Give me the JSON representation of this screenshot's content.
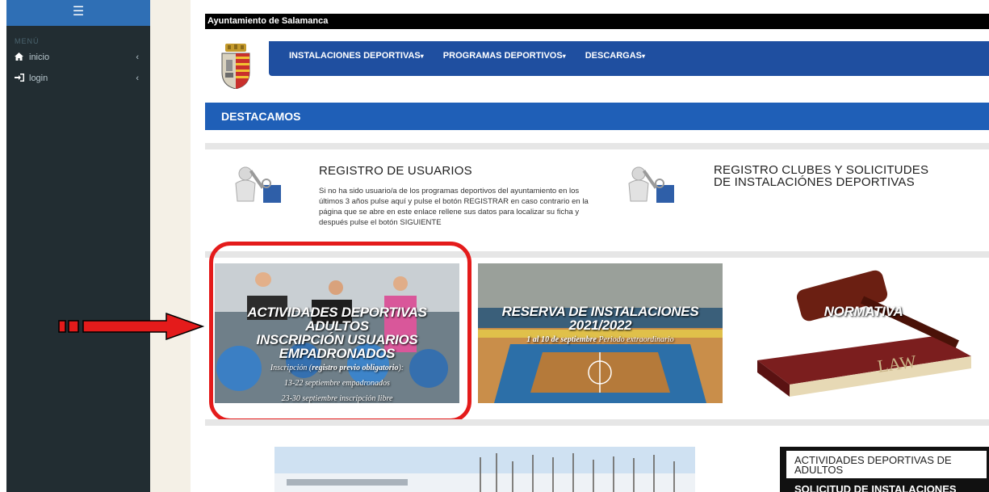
{
  "sidebar": {
    "toggle_icon": "hamburger-icon",
    "menu_title": "MENÚ",
    "items": [
      {
        "icon": "home-icon",
        "label": "inicio"
      },
      {
        "icon": "login-icon",
        "label": "login"
      }
    ]
  },
  "header": {
    "site_title": "Ayuntamiento de Salamanca",
    "nav": [
      {
        "label": "INSTALACIONES DEPORTIVAS"
      },
      {
        "label": "PROGRAMAS DEPORTIVOS"
      },
      {
        "label": "DESCARGAS"
      }
    ]
  },
  "featured": {
    "section_title": "DESTACAMOS",
    "registro_usuarios": {
      "title": "REGISTRO DE USUARIOS",
      "text": "Si no ha sido usuario/a de los programas deportivos del ayuntamiento en los últimos 3 años pulse aquí y pulse el botón REGISTRAR en caso contrario en la página que se abre en este enlace rellene sus datos para localizar su ficha y después pulse el botón SIGUIENTE"
    },
    "registro_clubes": {
      "title_line1": "REGISTRO CLUBES Y SOLICITUDES",
      "title_line2": "DE INSTALACIÓNES DEPORTIVAS"
    }
  },
  "tiles": {
    "actividades": {
      "line1": "ACTIVIDADES DEPORTIVAS ADULTOS",
      "line2": "INSCRIPCIÓN USUARIOS",
      "line3": "EMPADRONADOS",
      "sub_pre": "Inscripción (",
      "sub_bold": "registro previo obligatorio",
      "sub_post": "):",
      "date1": "13-22 septiembre empadronados",
      "date2": "23-30 septiembre inscripción libre"
    },
    "reserva": {
      "line1": "RESERVA DE INSTALACIONES",
      "line2": "2021/2022",
      "sub_bold": "1 al 10 de septiembre",
      "sub_rest": " Periodo extraordinario"
    },
    "normativa": {
      "label": "NORMATIVA",
      "book_text": "LAW"
    }
  },
  "side_list": {
    "item1": "ACTIVIDADES DEPORTIVAS DE ADULTOS",
    "item2": "SOLICITUD DE INSTALACIONES"
  },
  "colors": {
    "sidebar_bg": "#222d32",
    "sidebar_top": "#2f6fb5",
    "navbar": "#1f4fa0",
    "section_header": "#1f5fb7",
    "annotation_red": "#e41b1b"
  }
}
